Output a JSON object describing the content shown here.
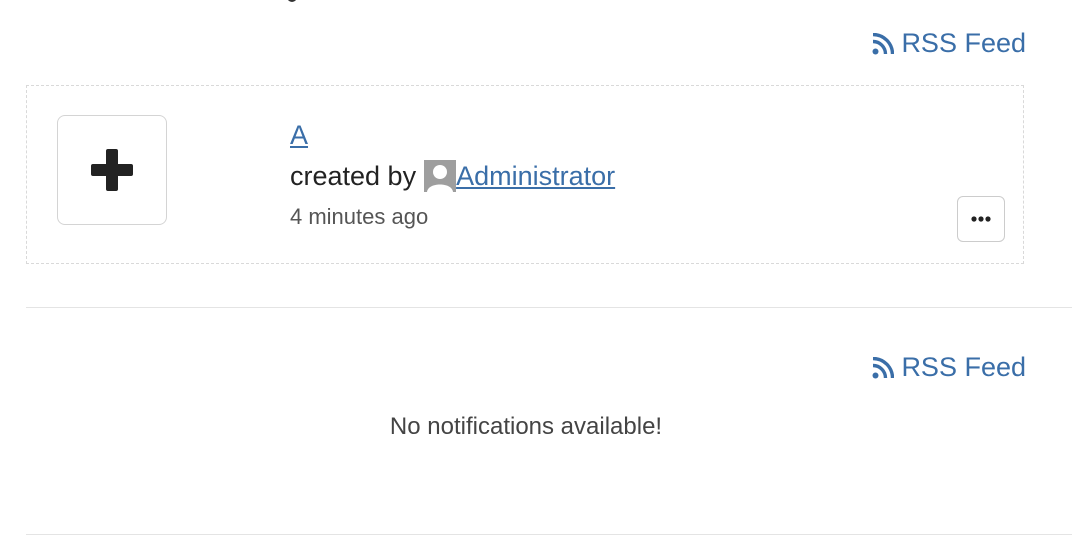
{
  "feed_top": {
    "rss_label": "RSS Feed"
  },
  "item": {
    "title": "A",
    "created_by_prefix": "created by",
    "author": "Administrator",
    "time_ago": "4 minutes ago",
    "add_icon": "plus-icon",
    "more_icon": "ellipsis-icon"
  },
  "notifications": {
    "rss_label": "RSS Feed",
    "empty_message": "No notifications available!"
  },
  "colors": {
    "link": "#3a6ea8",
    "border": "#d9d9d9",
    "text": "#333333"
  }
}
